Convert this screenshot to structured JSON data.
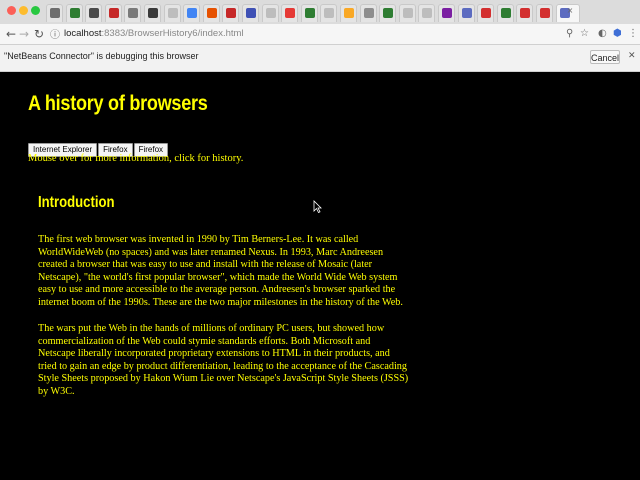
{
  "browser": {
    "url_host": "localhost",
    "url_rest": ":8383/BrowserHistory6/index.html",
    "debug_message": "\"NetBeans Connector\" is debugging this browser",
    "cancel_label": "Cancel",
    "tab_favicons": [
      "#6e6e6e",
      "#2e7d32",
      "#4a4a4a",
      "#c62828",
      "#7a7a7a",
      "#3a3a3a",
      "#bdbdbd",
      "#4285f4",
      "#e65100",
      "#c62828",
      "#3f51b5",
      "#bdbdbd",
      "#e53935",
      "#2e7d32",
      "#bdbdbd",
      "#f9a825",
      "#8e8e8e",
      "#2e7d32",
      "#bdbdbd",
      "#bdbdbd",
      "#7b1fa2",
      "#5c6bc0",
      "#d32f2f",
      "#2e7d32",
      "#d32f2f",
      "#d32f2f",
      "#5c6bc0"
    ]
  },
  "page": {
    "title": "A history of browsers",
    "buttons": [
      "Internet Explorer",
      "Firefox",
      "Firefox"
    ],
    "hint": "Mouse over for more information, click for history.",
    "section_title": "Introduction",
    "paragraphs": [
      "The first web browser was invented in 1990 by Tim Berners-Lee. It was called WorldWideWeb (no spaces) and was later renamed Nexus. In 1993, Marc Andreesen created a browser that was easy to use and install with the release of Mosaic (later Netscape), \"the world's first popular browser\", which made the World Wide Web system easy to use and more accessible to the average person. Andreesen's browser sparked the internet boom of the 1990s. These are the two major milestones in the history of the Web.",
      "The wars put the Web in the hands of millions of ordinary PC users, but showed how commercialization of the Web could stymie standards efforts. Both Microsoft and Netscape liberally incorporated proprietary extensions to HTML in their products, and tried to gain an edge by product differentiation, leading to the acceptance of the Cascading Style Sheets proposed by Hakon Wium Lie over Netscape's JavaScript Style Sheets (JSSS) by W3C."
    ]
  }
}
